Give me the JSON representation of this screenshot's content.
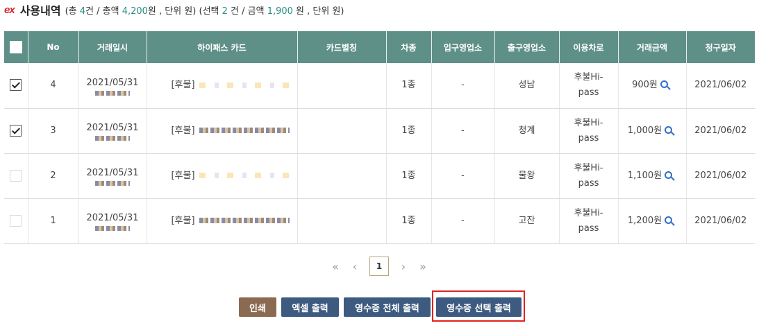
{
  "header": {
    "logo": "ex",
    "title": "사용내역",
    "summary": {
      "p1": "(총 ",
      "total_count": "4",
      "p2": "건 / 총액 ",
      "total_amount": "4,200",
      "p3": "원 , 단위 원) (선택 ",
      "selected_count": "2",
      "p4": " 건 / 금액 ",
      "selected_amount": "1,900",
      "p5": " 원 , 단위 원)"
    }
  },
  "table": {
    "headers": [
      "No",
      "거래일시",
      "하이패스 카드",
      "카드별칭",
      "차종",
      "입구영업소",
      "출구영업소",
      "이용차로",
      "거래금액",
      "청구일자"
    ],
    "rows": [
      {
        "checked": true,
        "no": "4",
        "date": "2021/05/31",
        "card": "[후불]",
        "alias": "",
        "vehicle": "1종",
        "entry": "-",
        "exit": "성남",
        "lane1": "후불Hi-",
        "lane2": "pass",
        "amount": "900원",
        "bill_date": "2021/06/02"
      },
      {
        "checked": true,
        "no": "3",
        "date": "2021/05/31",
        "card": "[후불]",
        "alias": "",
        "vehicle": "1종",
        "entry": "-",
        "exit": "청계",
        "lane1": "후불Hi-",
        "lane2": "pass",
        "amount": "1,000원",
        "bill_date": "2021/06/02"
      },
      {
        "checked": false,
        "no": "2",
        "date": "2021/05/31",
        "card": "[후불]",
        "alias": "",
        "vehicle": "1종",
        "entry": "-",
        "exit": "물왕",
        "lane1": "후불Hi-",
        "lane2": "pass",
        "amount": "1,100원",
        "bill_date": "2021/06/02"
      },
      {
        "checked": false,
        "no": "1",
        "date": "2021/05/31",
        "card": "[후불]",
        "alias": "",
        "vehicle": "1종",
        "entry": "-",
        "exit": "고잔",
        "lane1": "후불Hi-",
        "lane2": "pass",
        "amount": "1,200원",
        "bill_date": "2021/06/02"
      }
    ]
  },
  "pager": {
    "first": "«",
    "prev": "‹",
    "current": "1",
    "next": "›",
    "last": "»"
  },
  "buttons": {
    "print": "인쇄",
    "excel": "엑셀 출력",
    "receipt_all": "영수증 전체 출력",
    "receipt_selected": "영수증 선택 출력"
  },
  "colors": {
    "header_bg": "#5f9088",
    "accent_num": "#2a8c85",
    "btn_brown": "#8b6a52",
    "btn_navy": "#3d5a80",
    "highlight": "#e22121"
  },
  "icons": {
    "logo": "ex-logo",
    "detail": "magnifier-icon",
    "checkbox": "checkbox"
  }
}
